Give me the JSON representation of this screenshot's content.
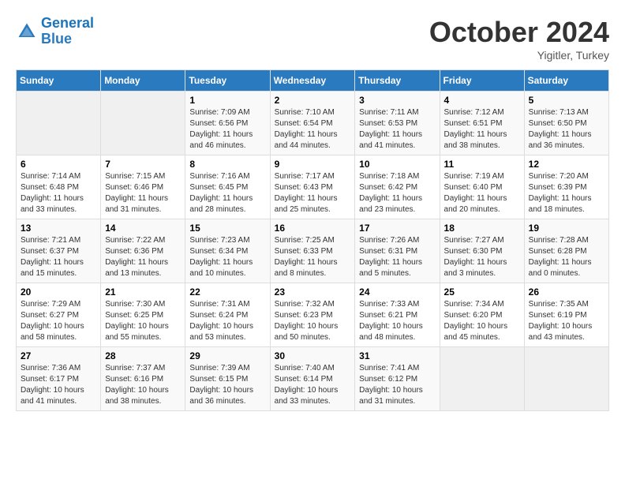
{
  "header": {
    "logo_line1": "General",
    "logo_line2": "Blue",
    "month": "October 2024",
    "location": "Yigitler, Turkey"
  },
  "weekdays": [
    "Sunday",
    "Monday",
    "Tuesday",
    "Wednesday",
    "Thursday",
    "Friday",
    "Saturday"
  ],
  "weeks": [
    [
      {
        "day": "",
        "info": ""
      },
      {
        "day": "",
        "info": ""
      },
      {
        "day": "1",
        "info": "Sunrise: 7:09 AM\nSunset: 6:56 PM\nDaylight: 11 hours and 46 minutes."
      },
      {
        "day": "2",
        "info": "Sunrise: 7:10 AM\nSunset: 6:54 PM\nDaylight: 11 hours and 44 minutes."
      },
      {
        "day": "3",
        "info": "Sunrise: 7:11 AM\nSunset: 6:53 PM\nDaylight: 11 hours and 41 minutes."
      },
      {
        "day": "4",
        "info": "Sunrise: 7:12 AM\nSunset: 6:51 PM\nDaylight: 11 hours and 38 minutes."
      },
      {
        "day": "5",
        "info": "Sunrise: 7:13 AM\nSunset: 6:50 PM\nDaylight: 11 hours and 36 minutes."
      }
    ],
    [
      {
        "day": "6",
        "info": "Sunrise: 7:14 AM\nSunset: 6:48 PM\nDaylight: 11 hours and 33 minutes."
      },
      {
        "day": "7",
        "info": "Sunrise: 7:15 AM\nSunset: 6:46 PM\nDaylight: 11 hours and 31 minutes."
      },
      {
        "day": "8",
        "info": "Sunrise: 7:16 AM\nSunset: 6:45 PM\nDaylight: 11 hours and 28 minutes."
      },
      {
        "day": "9",
        "info": "Sunrise: 7:17 AM\nSunset: 6:43 PM\nDaylight: 11 hours and 25 minutes."
      },
      {
        "day": "10",
        "info": "Sunrise: 7:18 AM\nSunset: 6:42 PM\nDaylight: 11 hours and 23 minutes."
      },
      {
        "day": "11",
        "info": "Sunrise: 7:19 AM\nSunset: 6:40 PM\nDaylight: 11 hours and 20 minutes."
      },
      {
        "day": "12",
        "info": "Sunrise: 7:20 AM\nSunset: 6:39 PM\nDaylight: 11 hours and 18 minutes."
      }
    ],
    [
      {
        "day": "13",
        "info": "Sunrise: 7:21 AM\nSunset: 6:37 PM\nDaylight: 11 hours and 15 minutes."
      },
      {
        "day": "14",
        "info": "Sunrise: 7:22 AM\nSunset: 6:36 PM\nDaylight: 11 hours and 13 minutes."
      },
      {
        "day": "15",
        "info": "Sunrise: 7:23 AM\nSunset: 6:34 PM\nDaylight: 11 hours and 10 minutes."
      },
      {
        "day": "16",
        "info": "Sunrise: 7:25 AM\nSunset: 6:33 PM\nDaylight: 11 hours and 8 minutes."
      },
      {
        "day": "17",
        "info": "Sunrise: 7:26 AM\nSunset: 6:31 PM\nDaylight: 11 hours and 5 minutes."
      },
      {
        "day": "18",
        "info": "Sunrise: 7:27 AM\nSunset: 6:30 PM\nDaylight: 11 hours and 3 minutes."
      },
      {
        "day": "19",
        "info": "Sunrise: 7:28 AM\nSunset: 6:28 PM\nDaylight: 11 hours and 0 minutes."
      }
    ],
    [
      {
        "day": "20",
        "info": "Sunrise: 7:29 AM\nSunset: 6:27 PM\nDaylight: 10 hours and 58 minutes."
      },
      {
        "day": "21",
        "info": "Sunrise: 7:30 AM\nSunset: 6:25 PM\nDaylight: 10 hours and 55 minutes."
      },
      {
        "day": "22",
        "info": "Sunrise: 7:31 AM\nSunset: 6:24 PM\nDaylight: 10 hours and 53 minutes."
      },
      {
        "day": "23",
        "info": "Sunrise: 7:32 AM\nSunset: 6:23 PM\nDaylight: 10 hours and 50 minutes."
      },
      {
        "day": "24",
        "info": "Sunrise: 7:33 AM\nSunset: 6:21 PM\nDaylight: 10 hours and 48 minutes."
      },
      {
        "day": "25",
        "info": "Sunrise: 7:34 AM\nSunset: 6:20 PM\nDaylight: 10 hours and 45 minutes."
      },
      {
        "day": "26",
        "info": "Sunrise: 7:35 AM\nSunset: 6:19 PM\nDaylight: 10 hours and 43 minutes."
      }
    ],
    [
      {
        "day": "27",
        "info": "Sunrise: 7:36 AM\nSunset: 6:17 PM\nDaylight: 10 hours and 41 minutes."
      },
      {
        "day": "28",
        "info": "Sunrise: 7:37 AM\nSunset: 6:16 PM\nDaylight: 10 hours and 38 minutes."
      },
      {
        "day": "29",
        "info": "Sunrise: 7:39 AM\nSunset: 6:15 PM\nDaylight: 10 hours and 36 minutes."
      },
      {
        "day": "30",
        "info": "Sunrise: 7:40 AM\nSunset: 6:14 PM\nDaylight: 10 hours and 33 minutes."
      },
      {
        "day": "31",
        "info": "Sunrise: 7:41 AM\nSunset: 6:12 PM\nDaylight: 10 hours and 31 minutes."
      },
      {
        "day": "",
        "info": ""
      },
      {
        "day": "",
        "info": ""
      }
    ]
  ]
}
